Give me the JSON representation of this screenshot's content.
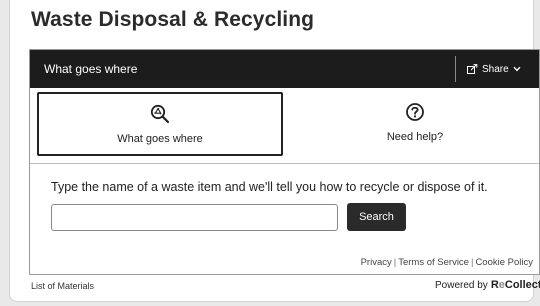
{
  "page": {
    "title": "Waste Disposal & Recycling"
  },
  "topbar": {
    "title": "What goes where",
    "share_label": "Share"
  },
  "tabs": [
    {
      "label": "What goes where",
      "icon": "recycle-search-icon",
      "active": true
    },
    {
      "label": "Need help?",
      "icon": "help-circle-icon",
      "active": false
    }
  ],
  "search": {
    "instruction": "Type the name of a waste item and we'll tell you how to recycle or dispose of it.",
    "placeholder": "",
    "value": "",
    "button_label": "Search"
  },
  "footer": {
    "links": [
      "Privacy",
      "Terms of Service",
      "Cookie Policy"
    ],
    "list_of_materials": "List of Materials",
    "powered_by": "Powered by",
    "brand_prefix": "R",
    "brand_mark": "e",
    "brand_suffix": "Collect"
  },
  "colors": {
    "bar_bg": "#1c1c1c",
    "button_bg": "#2a2a2a",
    "page_bg": "#e9e9e9"
  }
}
